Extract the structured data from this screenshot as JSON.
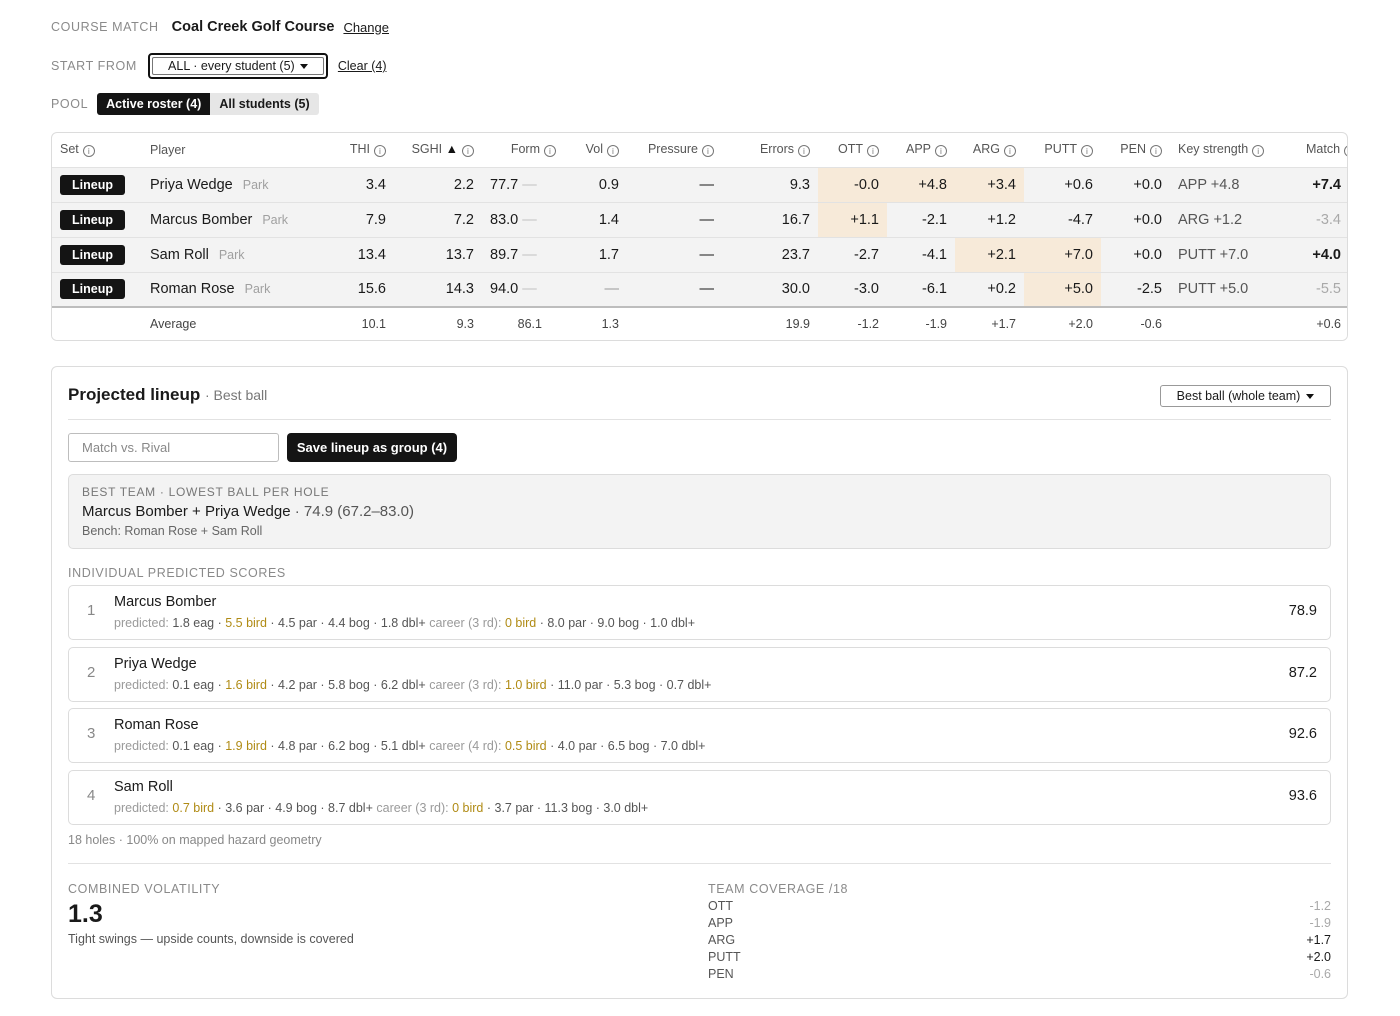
{
  "course": {
    "label": "COURSE MATCH",
    "name": "Coal Creek Golf Course",
    "change_label": "Change"
  },
  "start_from": {
    "label": "START FROM",
    "selected": "ALL · every student (5)",
    "clear_label": "Clear (4)"
  },
  "pool": {
    "label": "POOL",
    "options": [
      "Active roster (4)",
      "All students (5)"
    ],
    "selected_index": 0
  },
  "table": {
    "headers": {
      "set": "Set",
      "player": "Player",
      "thi": "THI",
      "sghi": "SGHI",
      "sort_arrow": "▲",
      "form": "Form",
      "vol": "Vol",
      "pressure": "Pressure",
      "errors": "Errors",
      "ott": "OTT",
      "app": "APP",
      "arg": "ARG",
      "putt": "PUTT",
      "pen": "PEN",
      "key": "Key strength",
      "match": "Match"
    },
    "info_glyph": "i",
    "badge_label": "Lineup",
    "course_type": "Park",
    "dash": "—",
    "rows": [
      {
        "name": "Priya Wedge",
        "thi": "3.4",
        "sghi": "2.2",
        "form": "77.7",
        "vol": "0.9",
        "pressure": "—",
        "errors": "9.3",
        "ott": "-0.0",
        "app": "+4.8",
        "arg": "+3.4",
        "putt": "+0.6",
        "pen": "+0.0",
        "key": "APP +4.8",
        "match": "+7.4"
      },
      {
        "name": "Marcus Bomber",
        "thi": "7.9",
        "sghi": "7.2",
        "form": "83.0",
        "vol": "1.4",
        "pressure": "—",
        "errors": "16.7",
        "ott": "+1.1",
        "app": "-2.1",
        "arg": "+1.2",
        "putt": "-4.7",
        "pen": "+0.0",
        "key": "ARG +1.2",
        "match": "-3.4"
      },
      {
        "name": "Sam Roll",
        "thi": "13.4",
        "sghi": "13.7",
        "form": "89.7",
        "vol": "1.7",
        "pressure": "—",
        "errors": "23.7",
        "ott": "-2.7",
        "app": "-4.1",
        "arg": "+2.1",
        "putt": "+7.0",
        "pen": "+0.0",
        "key": "PUTT +7.0",
        "match": "+4.0"
      },
      {
        "name": "Roman Rose",
        "thi": "15.6",
        "sghi": "14.3",
        "form": "94.0",
        "vol": "—",
        "pressure": "—",
        "errors": "30.0",
        "ott": "-3.0",
        "app": "-6.1",
        "arg": "+0.2",
        "putt": "+5.0",
        "pen": "-2.5",
        "key": "PUTT +5.0",
        "match": "-5.5"
      }
    ],
    "average": {
      "label": "Average",
      "thi": "10.1",
      "sghi": "9.3",
      "form": "86.1",
      "vol": "1.3",
      "errors": "19.9",
      "ott": "-1.2",
      "app": "-1.9",
      "arg": "+1.7",
      "putt": "+2.0",
      "pen": "-0.6",
      "match": "+0.6"
    }
  },
  "lineup": {
    "title": "Projected lineup",
    "subtitle": "· Best ball",
    "mode_select": "Best ball (whole team)",
    "input_placeholder": "Match vs. Rival",
    "save_label": "Save lineup as group (4)",
    "best": {
      "title": "BEST TEAM · LOWEST BALL PER HOLE",
      "players": "Marcus Bomber + Priya Wedge",
      "score": "· 74.9 (67.2–83.0)",
      "bench": "Bench: Roman Rose + Sam Roll"
    },
    "section_label": "INDIVIDUAL PREDICTED SCORES",
    "predictions": [
      {
        "rank": "1",
        "name": "Marcus Bomber",
        "pred_label": "predicted:",
        "pred_pre": "1.8 eag ·",
        "pred_bird": "5.5 bird",
        "pred_post": "· 4.5 par · 4.4 bog · 1.8 dbl+",
        "career_label": "career (3 rd):",
        "career_bird": "0 bird",
        "career_post": "· 8.0 par · 9.0 bog · 1.0 dbl+",
        "score": "78.9"
      },
      {
        "rank": "2",
        "name": "Priya Wedge",
        "pred_label": "predicted:",
        "pred_pre": "0.1 eag ·",
        "pred_bird": "1.6 bird",
        "pred_post": "· 4.2 par · 5.8 bog · 6.2 dbl+",
        "career_label": "career (3 rd):",
        "career_bird": "1.0 bird",
        "career_post": "· 11.0 par · 5.3 bog · 0.7 dbl+",
        "score": "87.2"
      },
      {
        "rank": "3",
        "name": "Roman Rose",
        "pred_label": "predicted:",
        "pred_pre": "0.1 eag ·",
        "pred_bird": "1.9 bird",
        "pred_post": "· 4.8 par · 6.2 bog · 5.1 dbl+",
        "career_label": "career (4 rd):",
        "career_bird": "0.5 bird",
        "career_post": "· 4.0 par · 6.5 bog · 7.0 dbl+",
        "score": "92.6"
      },
      {
        "rank": "4",
        "name": "Sam Roll",
        "pred_label": "predicted:",
        "pred_pre": "",
        "pred_bird": "0.7 bird",
        "pred_post": "· 3.6 par · 4.9 bog · 8.7 dbl+",
        "career_label": "career (3 rd):",
        "career_bird": "0 bird",
        "career_post": "· 3.7 par · 11.3 bog · 3.0 dbl+",
        "score": "93.6"
      }
    ],
    "footnote": "18 holes · 100% on mapped hazard geometry",
    "volatility": {
      "label": "COMBINED VOLATILITY",
      "value": "1.3",
      "desc": "Tight swings — upside counts, downside is covered"
    },
    "coverage": {
      "label": "TEAM COVERAGE /18",
      "rows": [
        {
          "name": "OTT",
          "value": "-1.2"
        },
        {
          "name": "APP",
          "value": "-1.9"
        },
        {
          "name": "ARG",
          "value": "+1.7"
        },
        {
          "name": "PUTT",
          "value": "+2.0"
        },
        {
          "name": "PEN",
          "value": "-0.6"
        }
      ]
    }
  },
  "colors": {
    "highlight": "#f7ead9",
    "bird": "#b08b15",
    "dark": "#141414"
  }
}
